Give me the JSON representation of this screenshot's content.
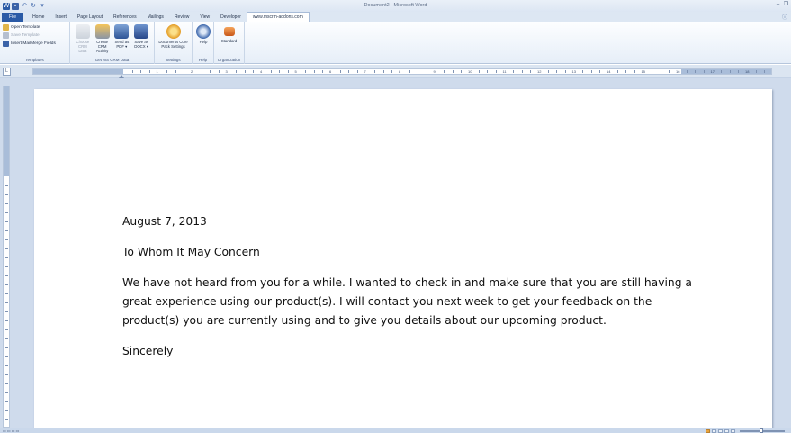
{
  "window": {
    "title": "Document2 - Microsoft Word"
  },
  "tabs": [
    {
      "label": "File",
      "kind": "file"
    },
    {
      "label": "Home",
      "kind": "normal"
    },
    {
      "label": "Insert",
      "kind": "normal"
    },
    {
      "label": "Page Layout",
      "kind": "normal"
    },
    {
      "label": "References",
      "kind": "normal"
    },
    {
      "label": "Mailings",
      "kind": "normal"
    },
    {
      "label": "Review",
      "kind": "normal"
    },
    {
      "label": "View",
      "kind": "normal"
    },
    {
      "label": "Developer",
      "kind": "normal"
    },
    {
      "label": "www.mscrm-addons.com",
      "kind": "active"
    }
  ],
  "ribbon": {
    "templates": {
      "label": "Templates",
      "open_template": "Open Template",
      "save_template": "Save Template",
      "insert_mailmerge": "Insert MailMerge Fields"
    },
    "crm_data": {
      "label": "Get MS CRM Data",
      "choose": "Choose\nCRM Data",
      "create_activity": "Create CRM\nActivity",
      "send_pdf": "Send as\nPDF ▾",
      "save_docx": "Save as\nDOCX ▾"
    },
    "settings": {
      "label": "Settings",
      "core_pack": "Documents Core\nPack Settings"
    },
    "help": {
      "label": "Help",
      "help_btn": "Help"
    },
    "organization": {
      "label": "Organization",
      "standard": "Standard"
    }
  },
  "ruler": {
    "corner": "L",
    "numbers": [
      "1",
      "2",
      "3",
      "4",
      "5",
      "6",
      "7",
      "8",
      "9",
      "10",
      "11",
      "12",
      "13",
      "14",
      "15",
      "16",
      "17",
      "18"
    ]
  },
  "document": {
    "date": "August 7, 2013",
    "salutation": "To Whom It May Concern",
    "body": "We have not heard from you for a while. I wanted to check in and make sure that you are still having a great experience using our product(s). I will contact you next week to get your feedback on the product(s) you are currently using and to give you details about our upcoming product.",
    "closing": "Sincerely"
  },
  "colors": {
    "file_tab": "#2a5aa6",
    "workspace": "#cfdbec"
  }
}
